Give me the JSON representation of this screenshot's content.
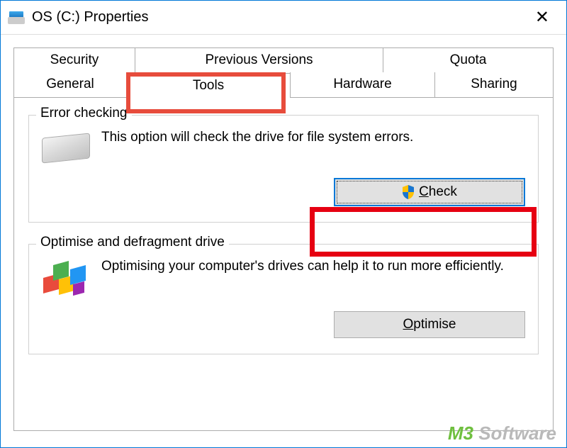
{
  "titlebar": {
    "title": "OS (C:) Properties"
  },
  "tabs": {
    "row1": [
      "Security",
      "Previous Versions",
      "Quota"
    ],
    "row2": [
      "General",
      "Tools",
      "Hardware",
      "Sharing"
    ],
    "active": "Tools"
  },
  "groups": {
    "errorChecking": {
      "legend": "Error checking",
      "description": "This option will check the drive for file system errors.",
      "button": "Check"
    },
    "optimise": {
      "legend": "Optimise and defragment drive",
      "description": "Optimising your computer's drives can help it to run more efficiently.",
      "button": "Optimise"
    }
  },
  "watermark": {
    "prefix": "M3",
    "suffix": " Software"
  }
}
